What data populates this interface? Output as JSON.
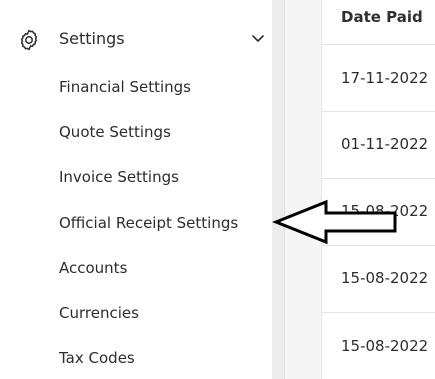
{
  "sidebar": {
    "settings_label": "Settings",
    "items": [
      {
        "label": "Financial Settings"
      },
      {
        "label": "Quote Settings"
      },
      {
        "label": "Invoice Settings"
      },
      {
        "label": "Official Receipt Settings"
      },
      {
        "label": "Accounts"
      },
      {
        "label": "Currencies"
      },
      {
        "label": "Tax Codes"
      }
    ]
  },
  "table": {
    "header": "Date Paid",
    "rows": [
      {
        "date_paid": "17-11-2022"
      },
      {
        "date_paid": "01-11-2022"
      },
      {
        "date_paid": "15-08-2022"
      },
      {
        "date_paid": "15-08-2022"
      },
      {
        "date_paid": "15-08-2022"
      }
    ]
  },
  "icons": {
    "settings": "gear-icon",
    "expand": "chevron-down-icon",
    "annotation": "arrow-left-icon"
  },
  "colors": {
    "text": "#2d2d2d",
    "content_bg": "#f5f5f6",
    "divider": "#ececec"
  }
}
